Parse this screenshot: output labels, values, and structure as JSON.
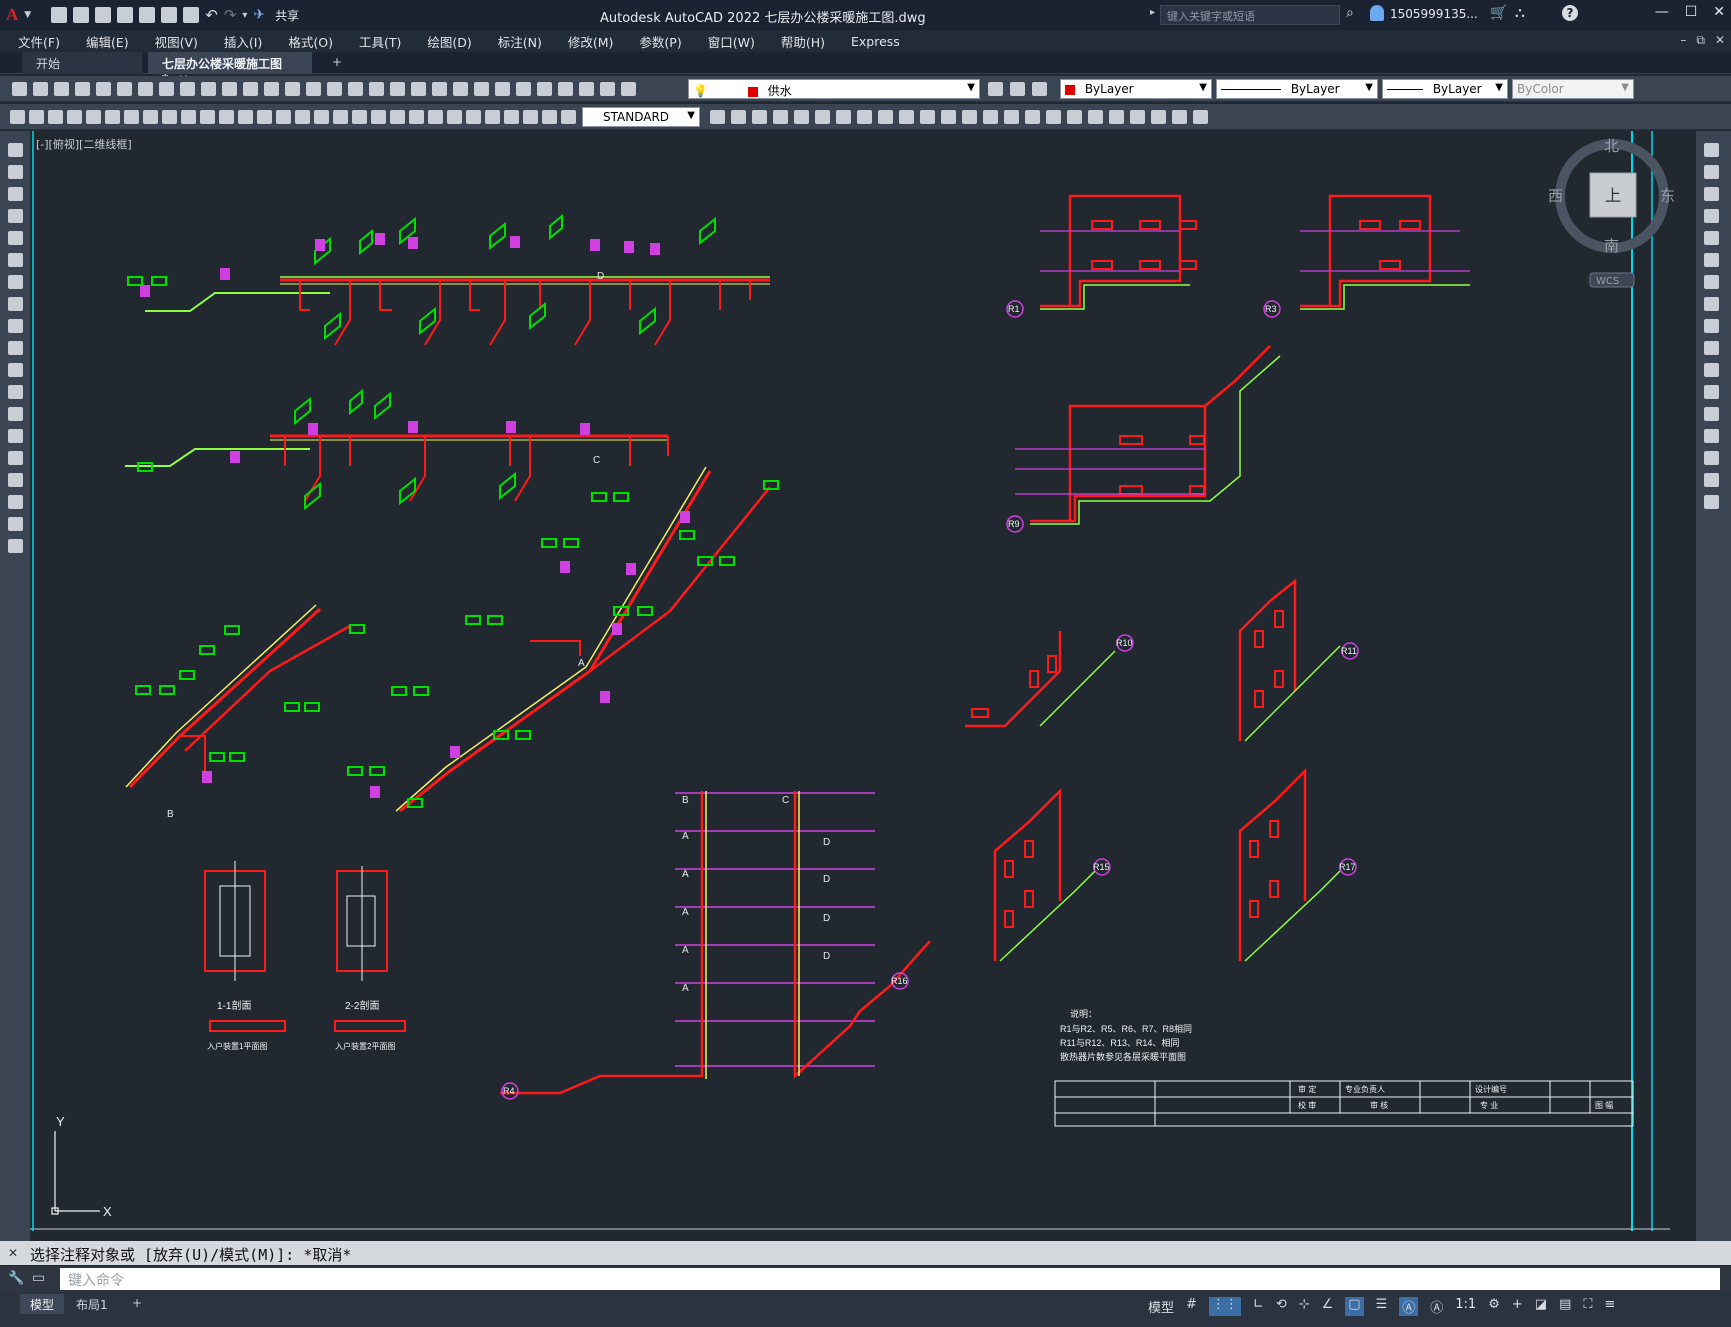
{
  "app": {
    "title": "Autodesk AutoCAD 2022    七层办公楼采暖施工图.dwg",
    "share_label": "共享",
    "search_placeholder": "键入关键字或短语",
    "user": "1505999135...",
    "logo": "A"
  },
  "menu": [
    "文件(F)",
    "编辑(E)",
    "视图(V)",
    "插入(I)",
    "格式(O)",
    "工具(T)",
    "绘图(D)",
    "标注(N)",
    "修改(M)",
    "参数(P)",
    "窗口(W)",
    "帮助(H)",
    "Express"
  ],
  "tabs": {
    "start": "开始",
    "document": "七层办公楼采暖施工图*"
  },
  "toolbar": {
    "layer": "供水",
    "color": "ByLayer",
    "linetype": "ByLayer",
    "lineweight": "ByLayer",
    "plotstyle": "ByColor",
    "textstyle": "STANDARD"
  },
  "viewport": {
    "label": "[-][俯视][二维线框]"
  },
  "viewcube": {
    "north": "北",
    "south": "南",
    "east": "东",
    "west": "西",
    "top": "上",
    "wcs": "WCS"
  },
  "ucs": {
    "x": "X",
    "y": "Y"
  },
  "drawing": {
    "riser_labels": [
      "R1",
      "R3",
      "R9",
      "R10",
      "R11",
      "R15",
      "R17",
      "R16",
      "R4"
    ],
    "section_letters": [
      "A",
      "B",
      "C",
      "D",
      "D",
      "D",
      "D",
      "D",
      "A",
      "A",
      "A",
      "A",
      "A",
      "B",
      "C"
    ],
    "detail_titles": [
      "1-1剖面",
      "2-2剖面",
      "入户装置1平面图",
      "入户装置2平面图"
    ],
    "notes_title": "说明：",
    "notes": [
      "R1与R2、R5、R6、R7、R8相同",
      "R11与R12、R13、R14、相同",
      "散热器片数参见各层采暖平面图"
    ],
    "title_block": [
      "审 定",
      "专业负责人",
      "设计编号",
      "校 审",
      "审 核",
      "专 业",
      "图 幅"
    ]
  },
  "command": {
    "history": "选择注释对象或 [放弃(U)/模式(M)]: *取消*",
    "placeholder": "键入命令"
  },
  "status": {
    "model_tab": "模型",
    "layout_tab": "布局1",
    "model_label": "模型",
    "scale": "1:1"
  },
  "colors": {
    "supply": "#ff1a1a",
    "return": "#90ff40",
    "yellow": "#f5f060",
    "magenta": "#d040e0",
    "cyan": "#00d8e8",
    "green": "#00e000",
    "bg": "#212830"
  }
}
